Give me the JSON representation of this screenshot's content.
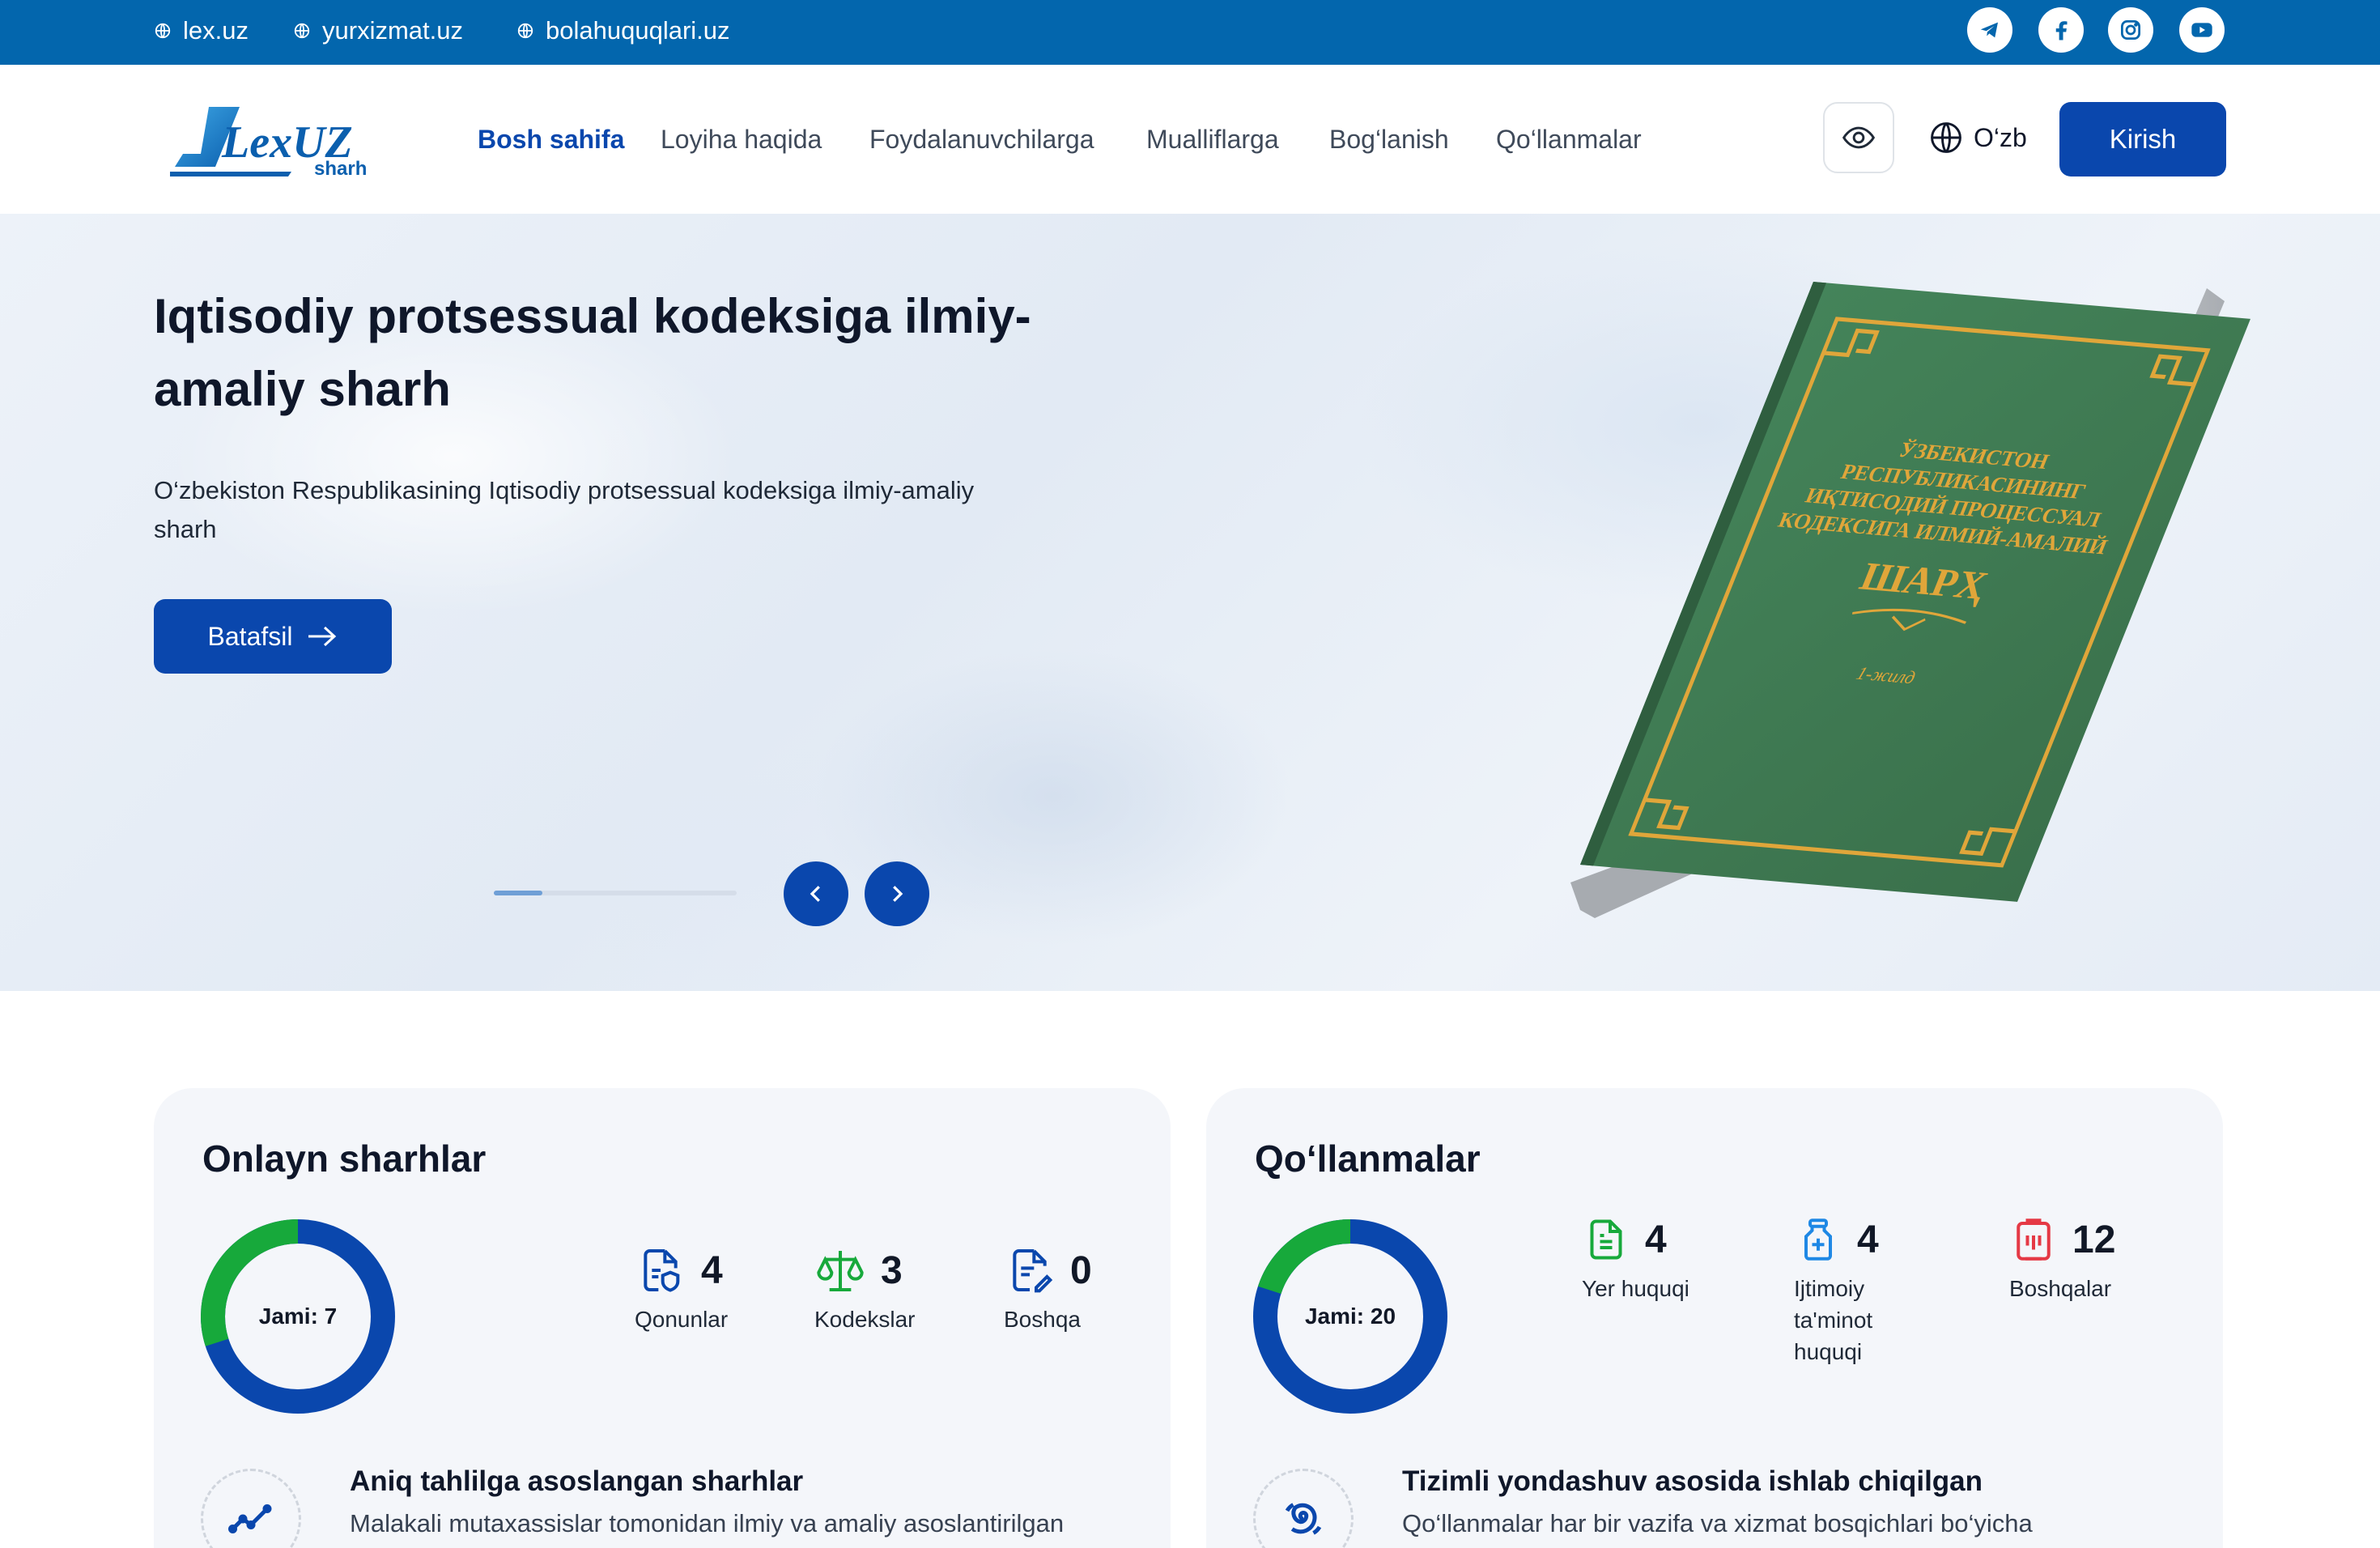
{
  "topbar": {
    "links": [
      "lex.uz",
      "yurxizmat.uz",
      "bolahuquqlari.uz"
    ],
    "social_icons": [
      "telegram-icon",
      "facebook-icon",
      "instagram-icon",
      "youtube-icon"
    ],
    "color": "#0366ad"
  },
  "header": {
    "logo_text": "LexUZ",
    "logo_subtext": "sharh",
    "nav": [
      "Bosh sahifa",
      "Loyiha haqida",
      "Foydalanuvchilarga",
      "Mualliflarga",
      "Bog‘lanish",
      "Qo‘llanmalar"
    ],
    "active_nav": "Bosh sahifa",
    "language": "O‘zb",
    "login_label": "Kirish",
    "accent": "#0a47ad"
  },
  "hero": {
    "title": "Iqtisodiy protsessual kodeksiga ilmiy-amaliy sharh",
    "description": "O‘zbekiston Respublikasining Iqtisodiy protsessual kodeksiga ilmiy-amaliy sharh",
    "button_label": "Batafsil",
    "slider_progress": 0.2,
    "book_cover": {
      "lines": [
        "ЎЗБЕКИСТОН",
        "РЕСПУБЛИКАСИНИНГ",
        "ИҚТИСОДИЙ ПРОЦЕССУАЛ",
        "КОДЕКСИГА ИЛМИЙ-АМАЛИЙ"
      ],
      "heading": "ШАРҲ",
      "volume": "1-жилд",
      "cover_color": "#3f7a50",
      "ornament_color": "#e0a63a"
    }
  },
  "cards": [
    {
      "title": "Onlayn sharhlar",
      "donut": {
        "label": "Jami: 7",
        "green_fraction": 0.3,
        "colors": {
          "primary": "#0a47ad",
          "secondary": "#17a93b"
        }
      },
      "stats": [
        {
          "value": "4",
          "label": "Qonunlar",
          "icon": "document-shield-icon",
          "color": "#0a47ad"
        },
        {
          "value": "3",
          "label": "Kodekslar",
          "icon": "scales-icon",
          "color": "#17a93b"
        },
        {
          "value": "0",
          "label": "Boshqa",
          "icon": "document-edit-icon",
          "color": "#0a47ad"
        }
      ],
      "feature": {
        "title": "Aniq tahlilga asoslangan sharhlar",
        "text": "Malakali mutaxassislar tomonidan ilmiy va amaliy asoslantirilgan",
        "icon": "trend-line-icon"
      }
    },
    {
      "title": "Qo‘llanmalar",
      "donut": {
        "label": "Jami: 20",
        "green_fraction": 0.2,
        "colors": {
          "primary": "#0a47ad",
          "secondary": "#17a93b"
        }
      },
      "stats": [
        {
          "value": "4",
          "label": "Yer huquqi",
          "icon": "file-text-icon",
          "color": "#17a93b"
        },
        {
          "value": "4",
          "label": "Ijtimoiy ta'minot huquqi",
          "icon": "medicine-bottle-icon",
          "color": "#1e88e5"
        },
        {
          "value": "12",
          "label": "Boshqalar",
          "icon": "clipboard-icon",
          "color": "#e53945"
        }
      ],
      "feature": {
        "title": "Tizimli yondashuv asosida ishlab chiqilgan",
        "text": "Qo‘llanmalar har bir vazifa va xizmat bosqichlari bo‘yicha",
        "icon": "spiral-icon"
      }
    }
  ]
}
